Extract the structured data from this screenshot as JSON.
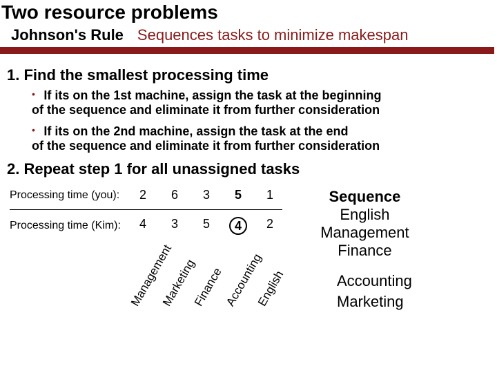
{
  "title": "Two resource problems",
  "rule": {
    "label": "Johnson's Rule",
    "desc": "Sequences tasks to minimize makespan"
  },
  "steps": {
    "s1": "1.  Find the smallest processing time",
    "b1a": "If its on the 1st machine, assign the task at the beginning",
    "b1b": "of the sequence and eliminate it from further consideration",
    "b2a": "If its on the 2nd machine, assign the task at the end",
    "b2b": "of the sequence and eliminate it from further consideration",
    "s2": "2.   Repeat step 1 for all unassigned tasks"
  },
  "chart_data": {
    "type": "table",
    "row_labels": [
      "Processing time (you):",
      "Processing time (Kim):"
    ],
    "categories": [
      "Management",
      "Marketing",
      "Finance",
      "Accounting",
      "English"
    ],
    "series": [
      {
        "name": "you",
        "values": [
          2,
          6,
          3,
          5,
          1
        ]
      },
      {
        "name": "Kim",
        "values": [
          4,
          3,
          5,
          4,
          2
        ]
      }
    ],
    "highlighted": {
      "you": [
        3
      ],
      "Kim": [
        3
      ]
    }
  },
  "sequence": {
    "head": "Sequence",
    "items": [
      "English",
      "Management",
      "Finance"
    ]
  },
  "remaining": [
    "Accounting",
    "Marketing"
  ]
}
